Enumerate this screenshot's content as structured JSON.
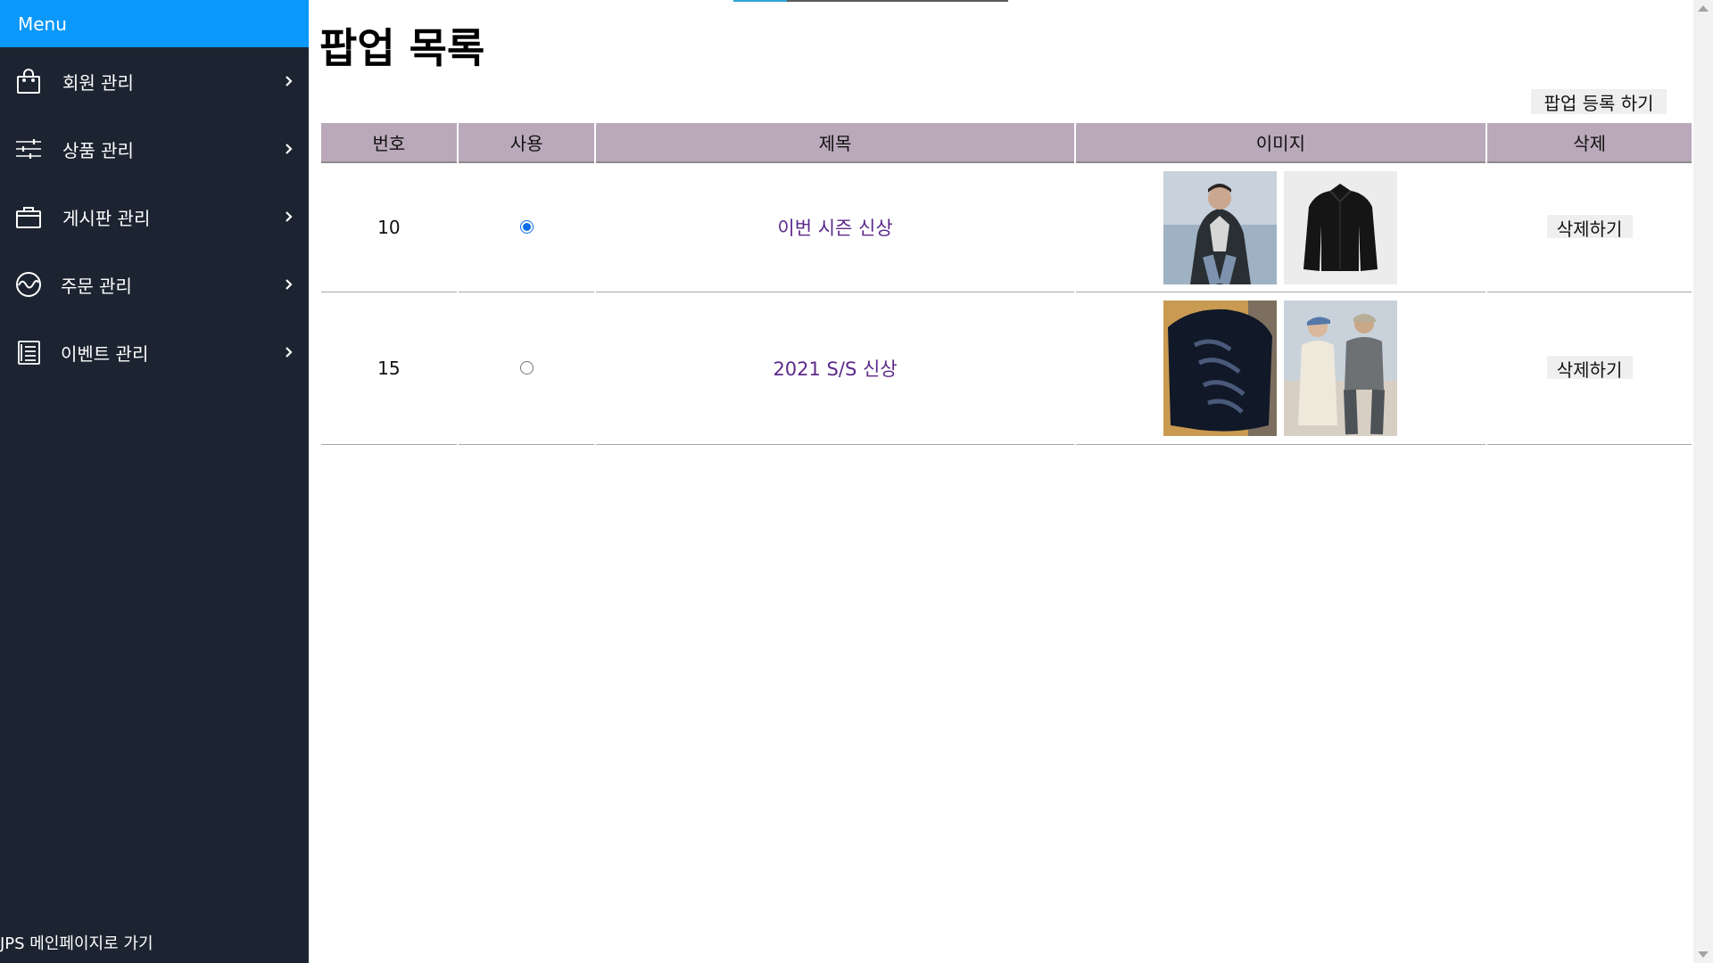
{
  "sidebar": {
    "header": "Menu",
    "items": [
      {
        "label": "회원 관리",
        "icon": "shopping-bag-icon"
      },
      {
        "label": "상품 관리",
        "icon": "sliders-icon"
      },
      {
        "label": "게시판 관리",
        "icon": "briefcase-icon"
      },
      {
        "label": "주문 관리",
        "icon": "activity-icon"
      },
      {
        "label": "이벤트 관리",
        "icon": "list-document-icon"
      }
    ],
    "footer_link": "JPS 메인페이지로 가기"
  },
  "main": {
    "title": "팝업 목록",
    "register_button": "팝업 등록 하기",
    "table": {
      "headers": [
        "번호",
        "사용",
        "제목",
        "이미지",
        "삭제"
      ],
      "rows": [
        {
          "no": "10",
          "active": true,
          "title": "이번 시즌 신상",
          "images": [
            "puffer-jacket-model-photo",
            "black-jacket-product-photo"
          ],
          "delete_label": "삭제하기"
        },
        {
          "no": "15",
          "active": false,
          "title": "2021 S/S 신상",
          "images": [
            "graphic-tshirt-back-photo",
            "couple-casual-outfit-photo"
          ],
          "delete_label": "삭제하기"
        }
      ]
    }
  },
  "colors": {
    "sidebar_bg": "#1b2430",
    "menu_header_bg": "#0a98fb",
    "table_header_bg": "#baa9ba",
    "link_color": "#5c2a8a"
  }
}
